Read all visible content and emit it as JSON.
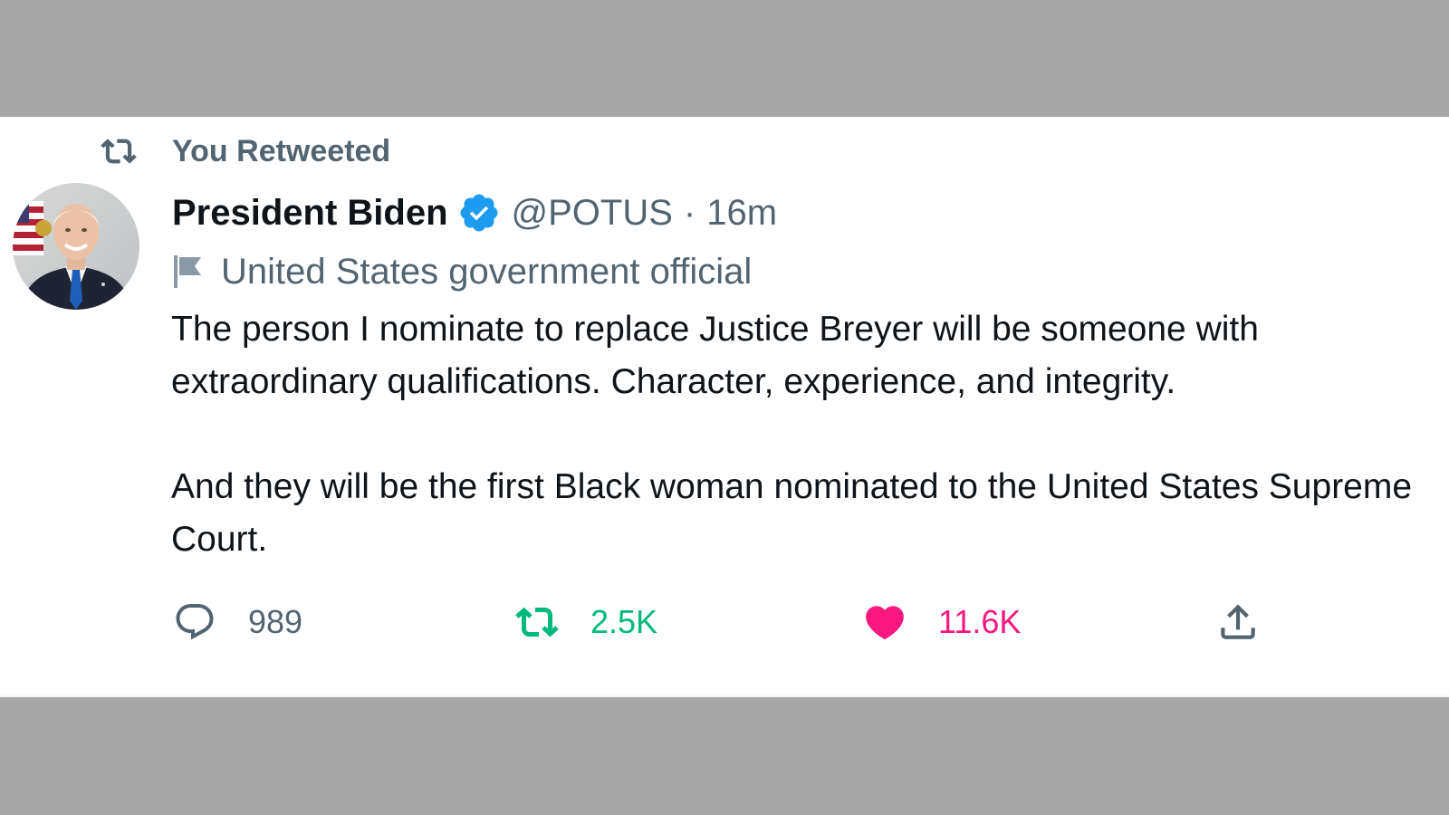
{
  "retweet_context": {
    "label": "You Retweeted"
  },
  "author": {
    "display_name": "President Biden",
    "handle": "@POTUS",
    "separator": "·",
    "timestamp": "16m",
    "verified": true,
    "account_label": "United States government official"
  },
  "tweet": {
    "paragraphs": [
      "The person I nominate to replace Justice Breyer will be someone with extraordinary qualifications. Character, experience, and integrity.",
      "And they will be the first Black woman nominated to the United States Supreme Court."
    ]
  },
  "actions": {
    "replies": "989",
    "retweets": "2.5K",
    "likes": "11.6K",
    "retweet_active": true,
    "like_active": true
  },
  "colors": {
    "text_primary": "#0f1419",
    "text_secondary": "#536471",
    "verified_blue": "#1d9bf0",
    "retweet_green": "#00ba7c",
    "like_pink": "#f91880",
    "backdrop_gray": "#a6a6a6"
  },
  "icons": {
    "retweet_context": "retweet-icon",
    "verified": "verified-badge-icon",
    "label": "flag-icon",
    "reply": "reply-icon",
    "retweet": "retweet-icon",
    "like": "heart-icon",
    "share": "share-icon"
  }
}
